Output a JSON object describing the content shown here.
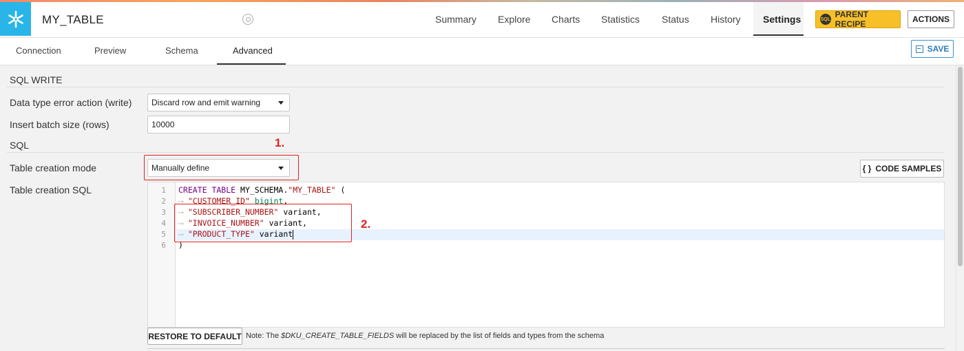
{
  "header": {
    "title": "MY_TABLE",
    "nav": [
      "Summary",
      "Explore",
      "Charts",
      "Statistics",
      "Status",
      "History",
      "Settings"
    ],
    "active_nav": "Settings",
    "parent_recipe_label": "PARENT RECIPE",
    "sql_badge": "SQL",
    "actions_label": "ACTIONS"
  },
  "subtabs": {
    "items": [
      "Connection",
      "Preview",
      "Schema",
      "Advanced"
    ],
    "active": "Advanced",
    "save_label": "SAVE"
  },
  "sql_write": {
    "section_title": "SQL WRITE",
    "error_action_label": "Data type error action (write)",
    "error_action_value": "Discard row and emit warning",
    "batch_size_label": "Insert batch size (rows)",
    "batch_size_value": "10000"
  },
  "sql": {
    "section_title": "SQL",
    "creation_mode_label": "Table creation mode",
    "creation_mode_value": "Manually define",
    "creation_sql_label": "Table creation SQL",
    "code_samples_label": "CODE SAMPLES",
    "code_samples_icon": "{ }",
    "line_numbers": [
      "1",
      "2",
      "3",
      "4",
      "5",
      "6"
    ],
    "code": {
      "l1_kw": "CREATE TABLE",
      "l1_plain": " MY_SCHEMA.",
      "l1_str": "\"MY_TABLE\"",
      "l1_end": " (",
      "l2_str": "\"CUSTOMER_ID\"",
      "l2_type": "bigint",
      "l2_end": ",",
      "l3_str": "\"SUBSCRIBER_NUMBER\"",
      "l3_rest": " variant,",
      "l4_str": "\"INVOICE_NUMBER\"",
      "l4_rest": " variant,",
      "l5_str": "\"PRODUCT_TYPE\"",
      "l5_rest": " variant",
      "l6": ")"
    },
    "restore_label": "RESTORE TO DEFAULT",
    "note_prefix": "Note: The ",
    "note_var": "$DKU_CREATE_TABLE_FIELDS",
    "note_suffix": " will be replaced by the list of fields and types from the schema"
  },
  "annotations": [
    "1.",
    "2."
  ],
  "colors": {
    "brand": "#29b5e8",
    "parent_recipe": "#f7c028",
    "annotation": "#e02020",
    "save": "#2b7bbb"
  }
}
